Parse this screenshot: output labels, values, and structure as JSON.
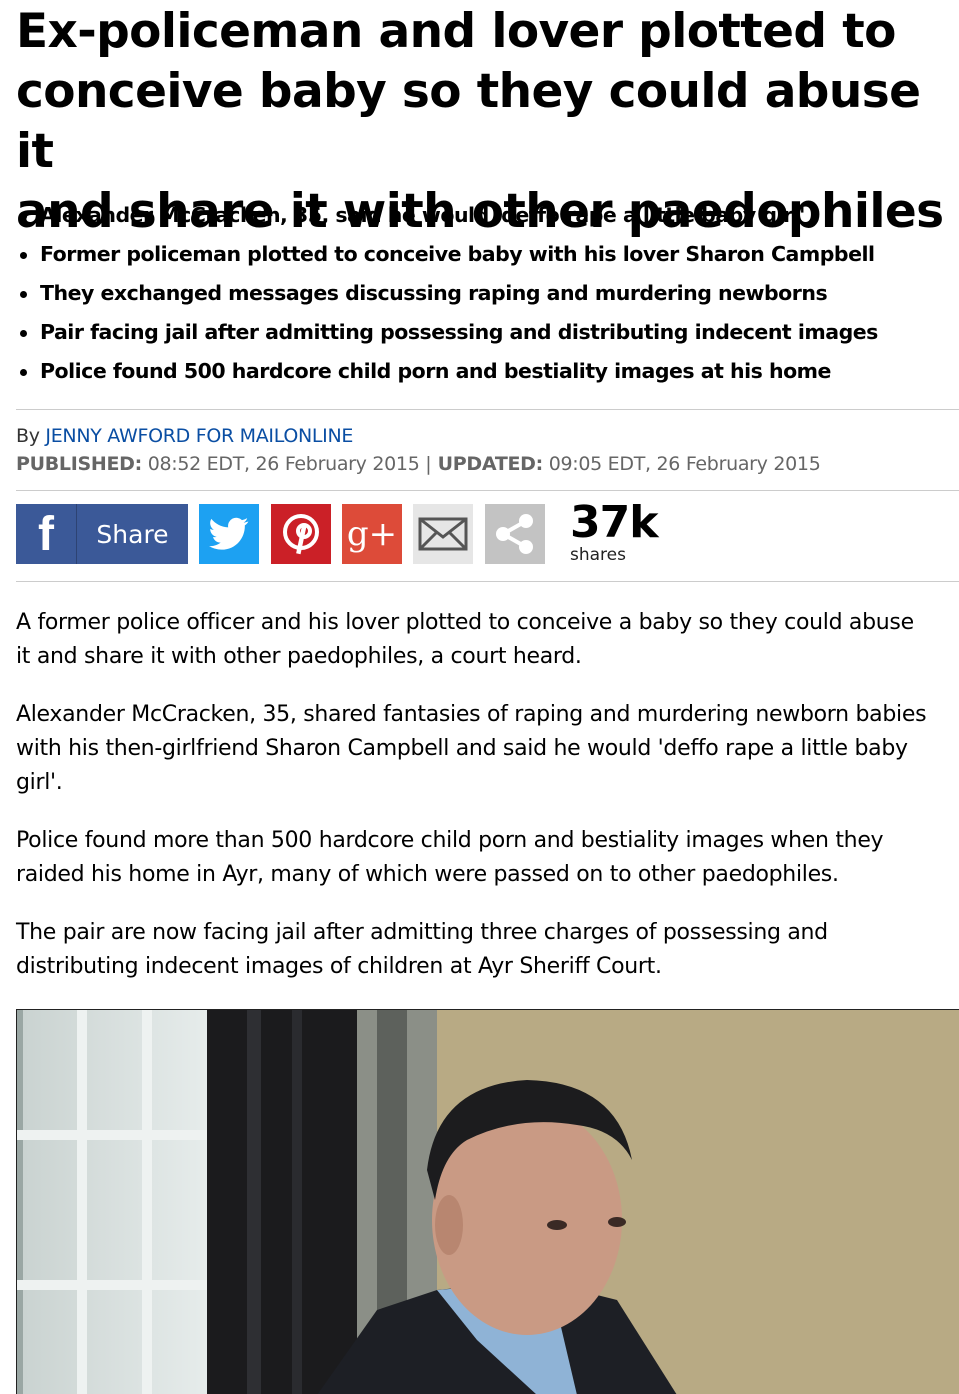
{
  "headline_lines": [
    "Ex-policeman and lover plotted to",
    "conceive baby so they could abuse it",
    "and share it with other paedophiles"
  ],
  "bullets": [
    "Alexander McCracken, 35, said he would 'deffo rape a little baby girl'",
    "Former policeman plotted to conceive baby with his lover Sharon Campbell",
    "They exchanged messages discussing raping and murdering newborns",
    "Pair facing jail after admitting possessing and distributing indecent images",
    "Police found 500 hardcore child porn and bestiality images at his home"
  ],
  "byline": {
    "prefix": "By ",
    "author": "JENNY AWFORD FOR MAILONLINE"
  },
  "dates": {
    "published_label": "PUBLISHED:",
    "published_value": " 08:52 EDT, 26 February 2015 ",
    "separator": "|",
    "updated_label": " UPDATED:",
    "updated_value": " 09:05 EDT, 26 February 2015"
  },
  "share": {
    "facebook_label": "Share",
    "count": "37k",
    "count_label": "shares",
    "icons": [
      "facebook-icon",
      "twitter-icon",
      "pinterest-icon",
      "google-plus-icon",
      "email-icon",
      "share-icon"
    ],
    "colors": {
      "facebook": "#3b5998",
      "twitter": "#1da1f2",
      "pinterest": "#cb2027",
      "google_plus": "#dd4b39",
      "email": "#e6e6e6",
      "more": "#c3c3c3"
    }
  },
  "paragraphs": [
    [
      "A former police officer and his lover plotted to conceive a baby so they could abuse",
      "it and share it with other paedophiles, a court heard."
    ],
    [
      "Alexander McCracken, 35, shared fantasies of raping and murdering newborn babies",
      "with his then-girlfriend Sharon Campbell and said he would 'deffo rape a little baby",
      "girl'."
    ],
    [
      "Police found more than 500 hardcore child porn and bestiality images when they",
      "raided his home in Ayr, many of which were passed on to other paedophiles."
    ],
    [
      "The pair are now facing jail after admitting three charges of possessing and",
      "distributing indecent images of children at Ayr Sheriff Court."
    ]
  ]
}
